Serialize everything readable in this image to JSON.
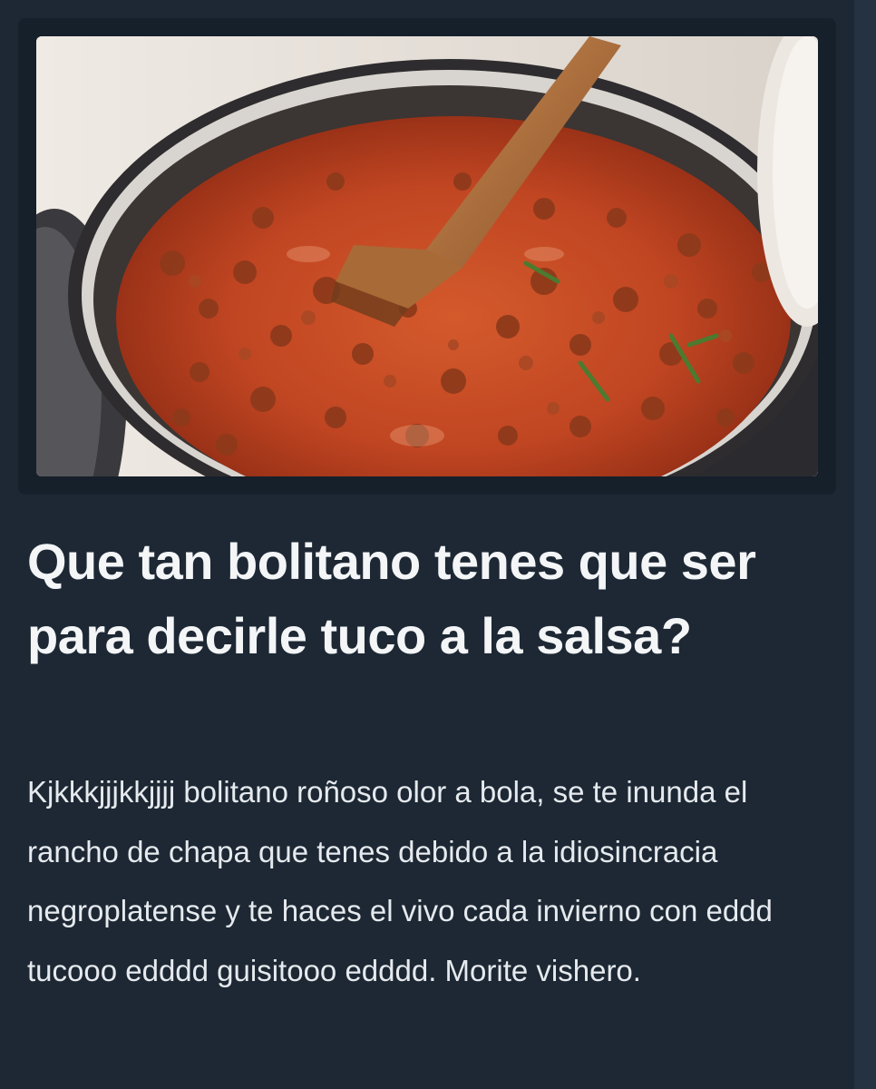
{
  "post": {
    "title": "Que tan bolitano tenes que ser para decirle tuco a la salsa?",
    "body": "Kjkkkjjjkkjjjj bolitano roñoso olor a bola, se te inunda el rancho de chapa que tenes debido a la idiosincracia negroplatense y te haces el vivo cada invierno con eddd tucooo edddd guisitooo edddd. Morite vishero.",
    "image": {
      "subject": "pan with meat tomato sauce and wooden spatula"
    }
  },
  "colors": {
    "background": "#1d2834",
    "card": "#16202b",
    "title_text": "#f3f5f7",
    "body_text": "#e6eaee",
    "sauce": "#c24a22"
  }
}
